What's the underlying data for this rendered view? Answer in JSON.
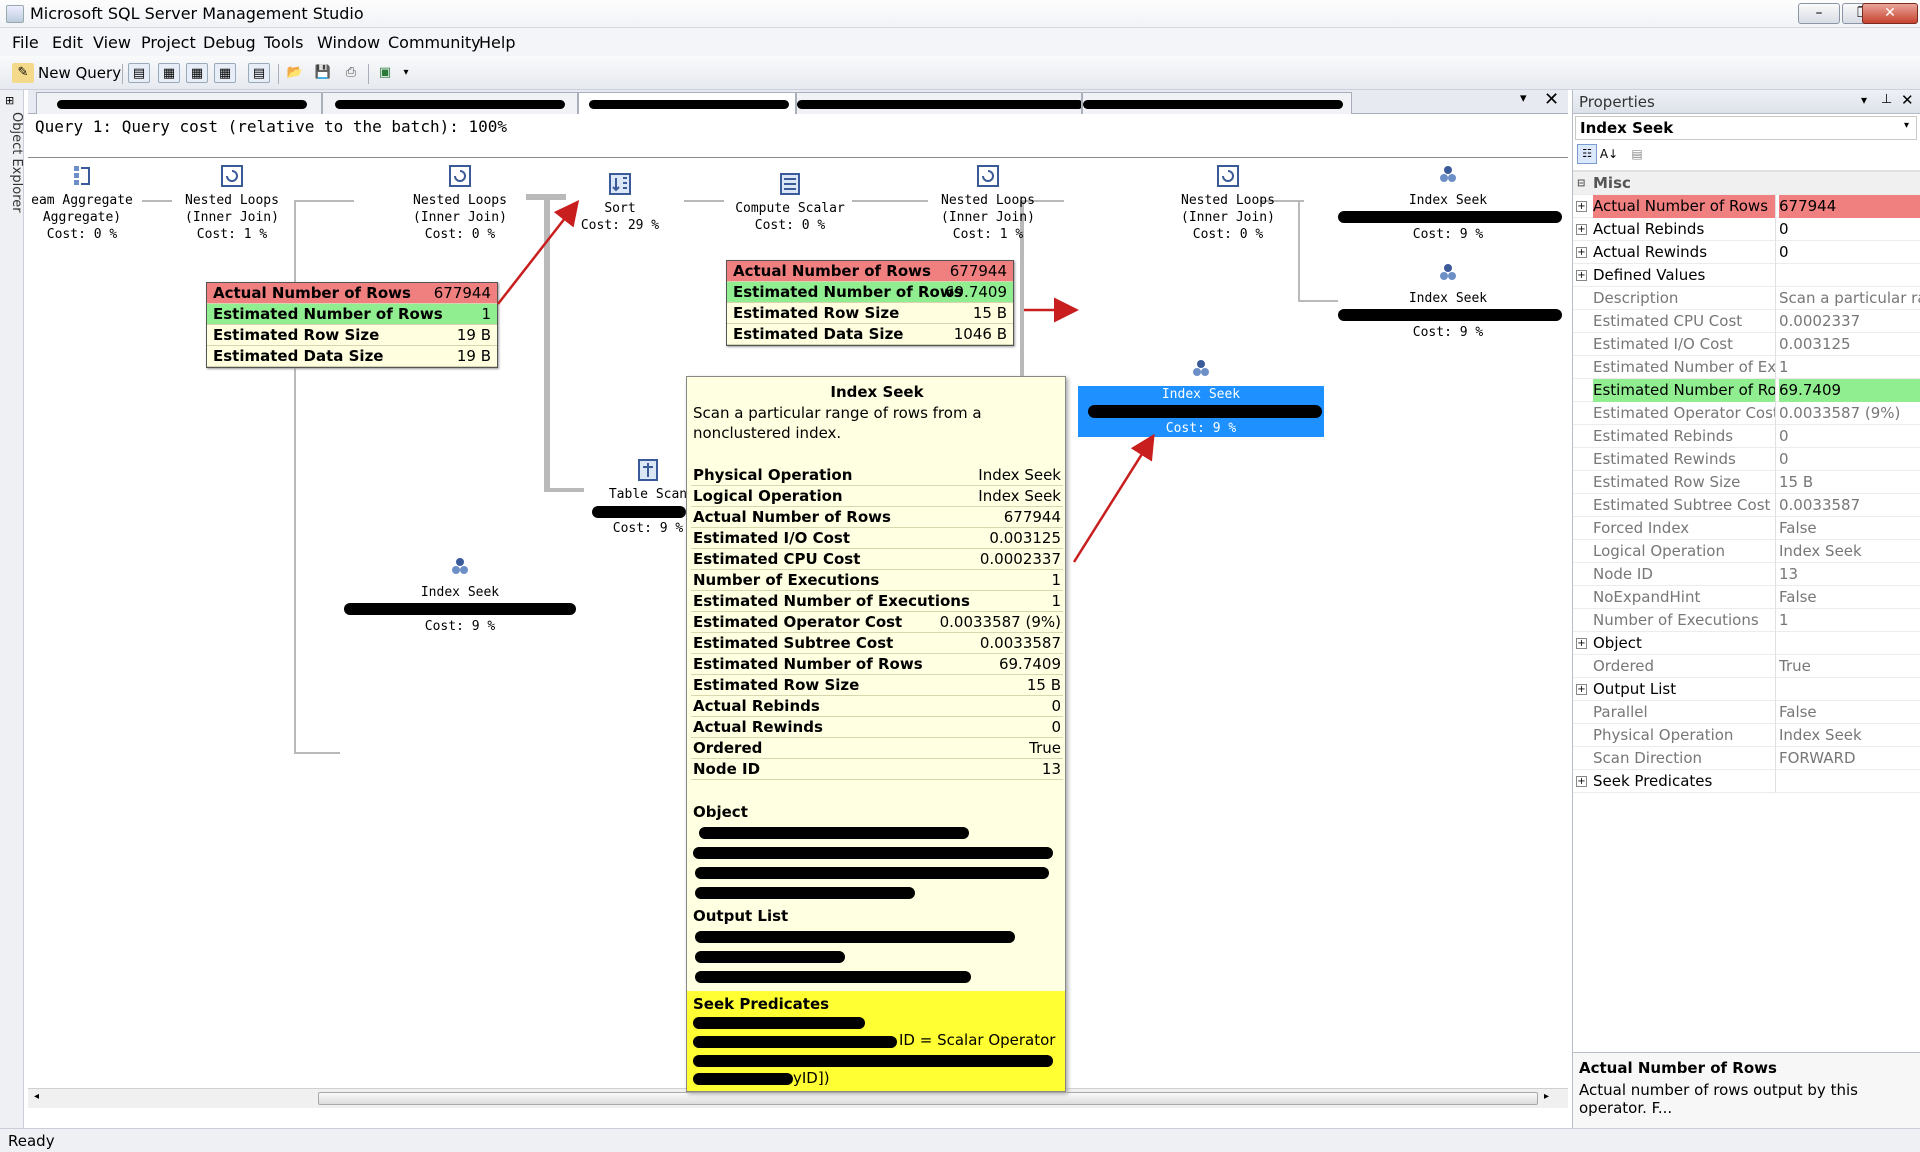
{
  "window": {
    "title": "Microsoft SQL Server Management Studio",
    "minimize": "–",
    "maximize": "❐",
    "close": "✕"
  },
  "menu": [
    "File",
    "Edit",
    "View",
    "Project",
    "Debug",
    "Tools",
    "Window",
    "Community",
    "Help"
  ],
  "toolbar": {
    "new_query": "New Query"
  },
  "left_rail": {
    "label": "Object Explorer"
  },
  "query_header": "Query 1: Query cost (relative to the batch): 100%",
  "plan": {
    "operators": [
      {
        "id": "stream-aggregate",
        "lines": [
          "eam Aggregate",
          "Aggregate)",
          "Cost: 0 %"
        ]
      },
      {
        "id": "nested-loops-1",
        "lines": [
          "Nested Loops",
          "(Inner Join)",
          "Cost: 1 %"
        ]
      },
      {
        "id": "nested-loops-2",
        "lines": [
          "Nested Loops",
          "(Inner Join)",
          "Cost: 0 %"
        ]
      },
      {
        "id": "sort",
        "lines": [
          "Sort",
          "Cost: 29 %"
        ]
      },
      {
        "id": "compute-scalar",
        "lines": [
          "Compute Scalar",
          "Cost: 0 %"
        ]
      },
      {
        "id": "nested-loops-3",
        "lines": [
          "Nested Loops",
          "(Inner Join)",
          "Cost: 1 %"
        ]
      },
      {
        "id": "nested-loops-4",
        "lines": [
          "Nested Loops",
          "(Inner Join)",
          "Cost: 0 %"
        ]
      },
      {
        "id": "index-seek-1",
        "lines": [
          "Index Seek",
          "",
          "Cost: 9 %"
        ]
      },
      {
        "id": "index-seek-2",
        "lines": [
          "Index Seek",
          "",
          "Cost: 9 %"
        ]
      },
      {
        "id": "index-seek-selected",
        "lines": [
          "Index Seek",
          "",
          "Cost: 9 %"
        ]
      },
      {
        "id": "table-scan",
        "lines": [
          "Table Scan",
          "",
          "Cost: 9 %"
        ]
      },
      {
        "id": "index-seek-3",
        "lines": [
          "Index Seek",
          "",
          "Cost: 9 %"
        ]
      }
    ],
    "stats_left": [
      {
        "label": "Actual Number of Rows",
        "value": "677944",
        "hl": "red"
      },
      {
        "label": "Estimated Number of Rows",
        "value": "1",
        "hl": "green"
      },
      {
        "label": "Estimated Row Size",
        "value": "19 B",
        "hl": ""
      },
      {
        "label": "Estimated Data Size",
        "value": "19 B",
        "hl": ""
      }
    ],
    "stats_mid": [
      {
        "label": "Actual Number of Rows",
        "value": "677944",
        "hl": "red"
      },
      {
        "label": "Estimated Number of Rows",
        "value": "69.7409",
        "hl": "green"
      },
      {
        "label": "Estimated Row Size",
        "value": "15 B",
        "hl": ""
      },
      {
        "label": "Estimated Data Size",
        "value": "1046 B",
        "hl": ""
      }
    ]
  },
  "tooltip": {
    "title": "Index Seek",
    "description": "Scan a particular range of rows from a nonclustered index.",
    "rows": [
      {
        "label": "Physical Operation",
        "value": "Index Seek"
      },
      {
        "label": "Logical Operation",
        "value": "Index Seek"
      },
      {
        "label": "Actual Number of Rows",
        "value": "677944"
      },
      {
        "label": "Estimated I/O Cost",
        "value": "0.003125"
      },
      {
        "label": "Estimated CPU Cost",
        "value": "0.0002337"
      },
      {
        "label": "Number of Executions",
        "value": "1"
      },
      {
        "label": "Estimated Number of Executions",
        "value": "1"
      },
      {
        "label": "Estimated Operator Cost",
        "value": "0.0033587 (9%)"
      },
      {
        "label": "Estimated Subtree Cost",
        "value": "0.0033587"
      },
      {
        "label": "Estimated Number of Rows",
        "value": "69.7409"
      },
      {
        "label": "Estimated Row Size",
        "value": "15 B"
      },
      {
        "label": "Actual Rebinds",
        "value": "0"
      },
      {
        "label": "Actual Rewinds",
        "value": "0"
      },
      {
        "label": "Ordered",
        "value": "True"
      },
      {
        "label": "Node ID",
        "value": "13"
      }
    ],
    "object_label": "Object",
    "output_label": "Output List",
    "seek_label": "Seek Predicates",
    "seek_fragment_1": "ID = Scalar Operator",
    "seek_fragment_2": "yID])"
  },
  "properties": {
    "title": "Properties",
    "object": "Index Seek",
    "category": "Misc",
    "rows": [
      {
        "key": "Actual Number of Rows",
        "value": "677944",
        "expand": true,
        "style": "red"
      },
      {
        "key": "Actual Rebinds",
        "value": "0",
        "expand": true,
        "style": ""
      },
      {
        "key": "Actual Rewinds",
        "value": "0",
        "expand": true,
        "style": ""
      },
      {
        "key": "Defined Values",
        "value": "",
        "expand": true,
        "style": ""
      },
      {
        "key": "Description",
        "value": "Scan a particular range",
        "expand": false,
        "style": "grey"
      },
      {
        "key": "Estimated CPU Cost",
        "value": "0.0002337",
        "expand": false,
        "style": "grey"
      },
      {
        "key": "Estimated I/O Cost",
        "value": "0.003125",
        "expand": false,
        "style": "grey"
      },
      {
        "key": "Estimated Number of Execu",
        "value": "1",
        "expand": false,
        "style": "grey"
      },
      {
        "key": "Estimated Number of Rows",
        "value": "69.7409",
        "expand": false,
        "style": "green"
      },
      {
        "key": "Estimated Operator Cost",
        "value": "0.0033587 (9%)",
        "expand": false,
        "style": "grey"
      },
      {
        "key": "Estimated Rebinds",
        "value": "0",
        "expand": false,
        "style": "grey"
      },
      {
        "key": "Estimated Rewinds",
        "value": "0",
        "expand": false,
        "style": "grey"
      },
      {
        "key": "Estimated Row Size",
        "value": "15 B",
        "expand": false,
        "style": "grey"
      },
      {
        "key": "Estimated Subtree Cost",
        "value": "0.0033587",
        "expand": false,
        "style": "grey"
      },
      {
        "key": "Forced Index",
        "value": "False",
        "expand": false,
        "style": "grey"
      },
      {
        "key": "Logical Operation",
        "value": "Index Seek",
        "expand": false,
        "style": "grey"
      },
      {
        "key": "Node ID",
        "value": "13",
        "expand": false,
        "style": "grey"
      },
      {
        "key": "NoExpandHint",
        "value": "False",
        "expand": false,
        "style": "grey"
      },
      {
        "key": "Number of Executions",
        "value": "1",
        "expand": false,
        "style": "grey"
      },
      {
        "key": "Object",
        "value": "",
        "expand": true,
        "style": ""
      },
      {
        "key": "Ordered",
        "value": "True",
        "expand": false,
        "style": "grey"
      },
      {
        "key": "Output List",
        "value": "",
        "expand": true,
        "style": ""
      },
      {
        "key": "Parallel",
        "value": "False",
        "expand": false,
        "style": "grey"
      },
      {
        "key": "Physical Operation",
        "value": "Index Seek",
        "expand": false,
        "style": "grey"
      },
      {
        "key": "Scan Direction",
        "value": "FORWARD",
        "expand": false,
        "style": "grey"
      },
      {
        "key": "Seek Predicates",
        "value": "",
        "expand": true,
        "style": ""
      }
    ],
    "desc_title": "Actual Number of Rows",
    "desc_text": "Actual number of rows output by this operator. F..."
  },
  "status": "Ready",
  "colors": {
    "selected": "#1e90ff",
    "red_highlight": "#f08080",
    "green_highlight": "#90ee90",
    "tooltip_bg": "#ffffe1",
    "seek_bg": "#ffff33"
  }
}
